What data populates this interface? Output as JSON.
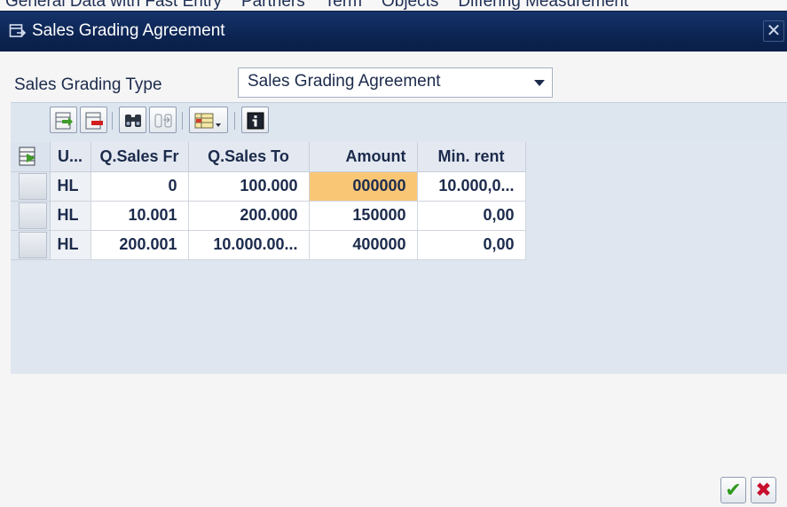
{
  "background_tabs": [
    "General Data with Fast Entry",
    "Partners",
    "Term",
    "Objects",
    "Differing Measurement"
  ],
  "dialog": {
    "title": "Sales Grading Agreement",
    "close_glyph": "✕",
    "title_icon": "dialog-window-icon"
  },
  "form": {
    "type_label": "Sales Grading Type",
    "type_value": "Sales Grading Agreement"
  },
  "toolbar": {
    "buttons": [
      "insert-row-icon",
      "delete-row-icon",
      "find-icon",
      "find-next-icon",
      "layout-menu-icon",
      "info-icon"
    ]
  },
  "grid": {
    "headers": [
      "U...",
      "Q.Sales Fr",
      "Q.Sales To",
      "Amount",
      "Min. rent"
    ],
    "rows": [
      [
        "HL",
        "0",
        "100.000",
        "000000",
        "10.000,0..."
      ],
      [
        "HL",
        "10.001",
        "200.000",
        "150000",
        "0,00"
      ],
      [
        "HL",
        "200.001",
        "10.000.00...",
        "400000",
        "0,00"
      ]
    ],
    "highlight_color": "#f9c676"
  },
  "footer": {
    "ok_glyph": "✔",
    "cancel_glyph": "✖",
    "ok_color": "#2e9a1b",
    "cancel_color": "#c8102e"
  }
}
